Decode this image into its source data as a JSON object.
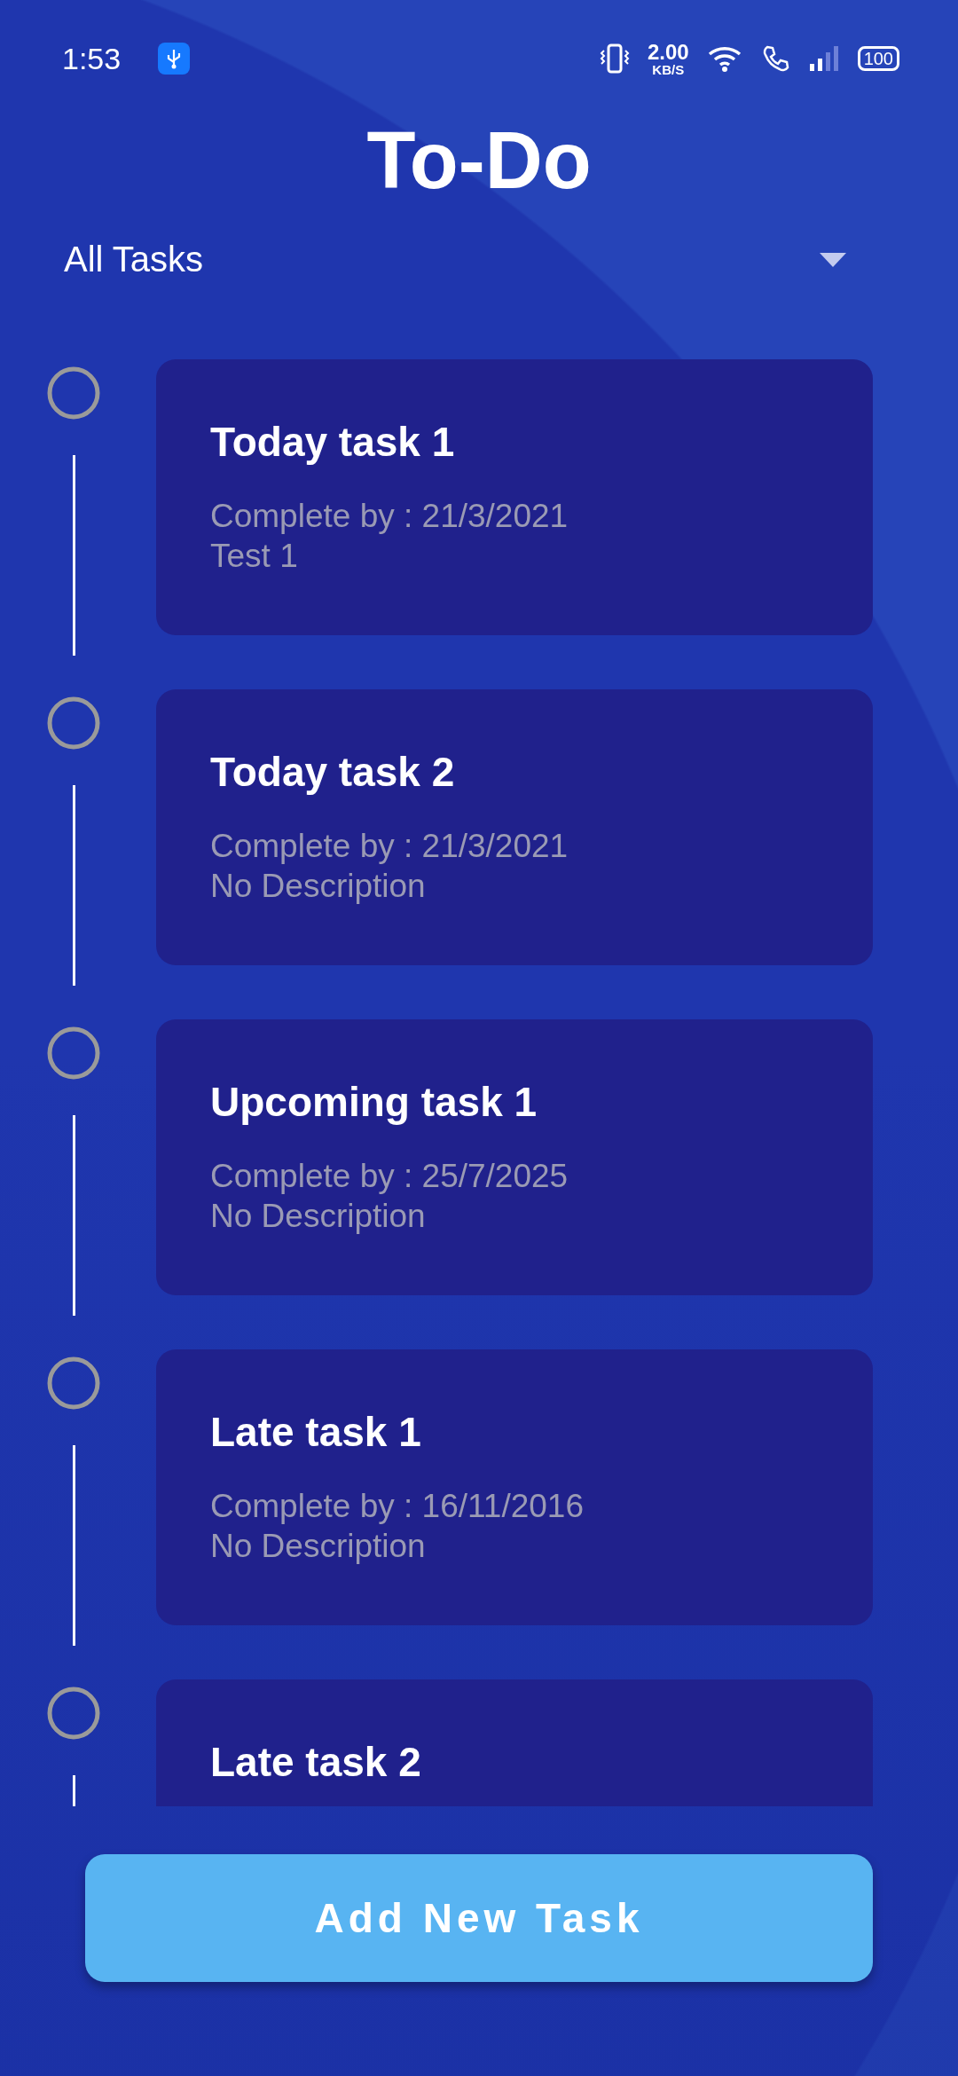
{
  "status_bar": {
    "time": "1:53",
    "speed_value": "2.00",
    "speed_unit": "KB/S",
    "battery": "100"
  },
  "title": "To-Do",
  "filter": {
    "value": "All Tasks"
  },
  "tasks": [
    {
      "title": "Today task 1",
      "done": false,
      "due": "Complete by : 21/3/2021",
      "description": "Test 1"
    },
    {
      "title": "Today task 2",
      "done": false,
      "due": "Complete by : 21/3/2021",
      "description": "No Description"
    },
    {
      "title": "Upcoming task 1",
      "done": false,
      "due": "Complete by : 25/7/2025",
      "description": "No Description"
    },
    {
      "title": "Late task 1",
      "done": false,
      "due": "Complete by : 16/11/2016",
      "description": "No Description"
    },
    {
      "title": "Late task 2",
      "done": false
    }
  ],
  "add_button": "Add New Task"
}
